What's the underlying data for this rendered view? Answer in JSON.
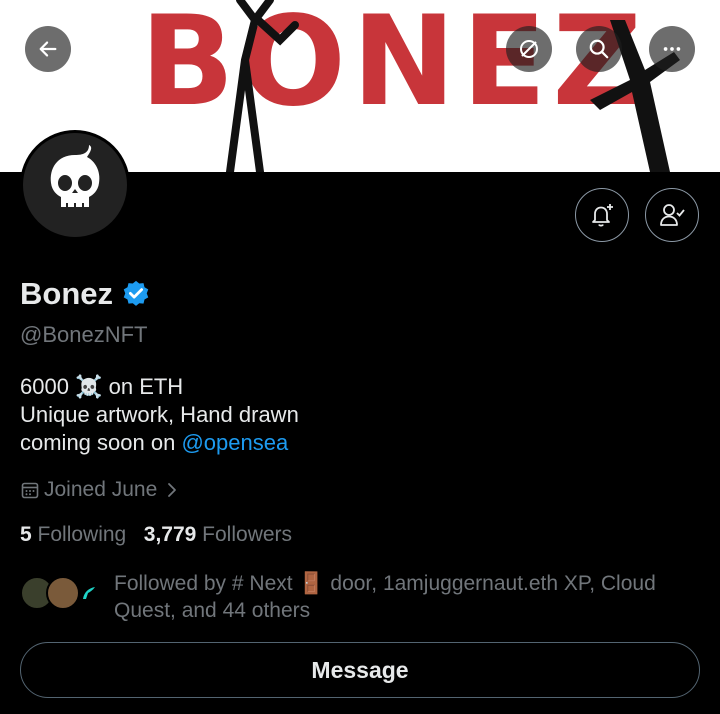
{
  "banner": {
    "title": "BONEZ"
  },
  "toolbar": {
    "back_icon": "arrow-left-icon",
    "grok_icon": "grok-icon",
    "search_icon": "search-icon",
    "more_icon": "more-icon"
  },
  "profile": {
    "name": "Bonez",
    "handle": "@BonezNFT",
    "bio_line1_prefix": "6000",
    "bio_line1_emoji": "☠️",
    "bio_line1_suffix": "on ETH",
    "bio_line2": "Unique artwork, Hand drawn",
    "bio_line3_prefix": "coming soon on",
    "bio_line3_link": "@opensea",
    "joined": "Joined June",
    "following_count": "5",
    "following_label": "Following",
    "followers_count": "3,779",
    "followers_label": "Followers",
    "followed_by": "Followed by # Next 🚪 door, 1amjuggernaut.eth XP, Cloud Quest, and 44 others"
  },
  "actions": {
    "message_label": "Message"
  },
  "colors": {
    "accent": "#1d9bf0",
    "banner_text": "#c8353a",
    "background": "#000000"
  }
}
